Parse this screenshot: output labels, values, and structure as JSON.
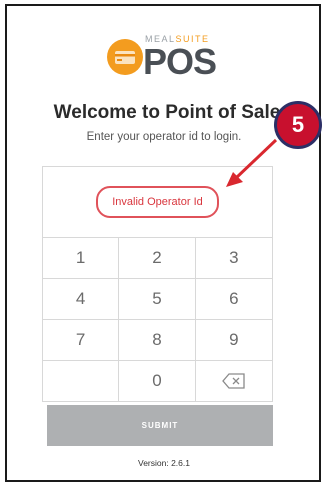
{
  "logo": {
    "brand_small_a": "MEAL",
    "brand_small_b": "SUITE",
    "brand_big": "POS"
  },
  "header": {
    "title": "Welcome to Point of Sale",
    "subtitle": "Enter your operator id to login."
  },
  "display": {
    "error": "Invalid Operator Id"
  },
  "keypad": {
    "keys": [
      "1",
      "2",
      "3",
      "4",
      "5",
      "6",
      "7",
      "8",
      "9",
      "",
      "0",
      ""
    ]
  },
  "submit_label": "SUBMIT",
  "version": "Version: 2.6.1",
  "annotation": {
    "step": "5"
  },
  "colors": {
    "accent": "#f39c1f",
    "error": "#d9363e",
    "badge": "#c8102e",
    "submit_bg": "#aeb0b2"
  }
}
